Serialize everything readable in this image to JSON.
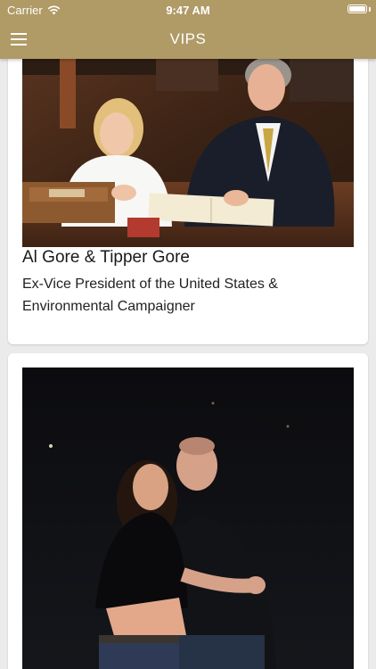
{
  "status_bar": {
    "carrier": "Carrier",
    "time": "9:47 AM",
    "battery_level": 1.0
  },
  "nav": {
    "title": "VIPS",
    "menu_icon": "hamburger-menu-icon"
  },
  "colors": {
    "header": "#b09a66",
    "background": "#ebebeb",
    "card": "#ffffff"
  },
  "vips": [
    {
      "name": "Al Gore & Tipper Gore",
      "description": "Ex-Vice President of the United States & Environmental Campaigner"
    },
    {
      "name": "",
      "description": ""
    }
  ]
}
